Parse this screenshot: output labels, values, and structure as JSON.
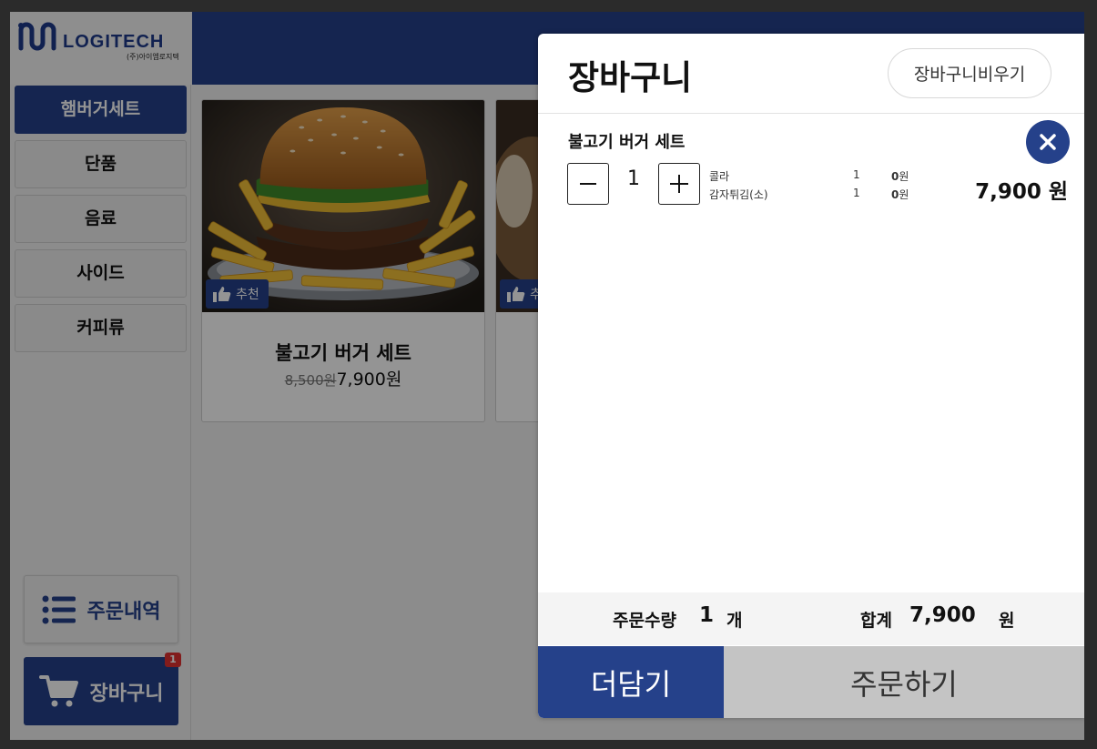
{
  "brand": {
    "logo_text": "LOGITECH",
    "sub_text": "(주)아이엠로지텍"
  },
  "sidebar": {
    "categories": [
      {
        "label": "햄버거세트",
        "active": true
      },
      {
        "label": "단품",
        "active": false
      },
      {
        "label": "음료",
        "active": false
      },
      {
        "label": "사이드",
        "active": false
      },
      {
        "label": "커피류",
        "active": false
      }
    ],
    "history_label": "주문내역",
    "cart_label": "장바구니",
    "cart_badge": "1"
  },
  "products": [
    {
      "badge": "추천",
      "name": "불고기 버거 세트",
      "old_price": "8,500원",
      "price": "7,900원"
    },
    {
      "badge": "추천"
    }
  ],
  "cart": {
    "title": "장바구니",
    "clear_label": "장바구니비우기",
    "item": {
      "name": "불고기 버거 세트",
      "quantity": "1",
      "options": [
        {
          "name": "콜라",
          "qty": "1",
          "price": "0",
          "unit": "원"
        },
        {
          "name": "감자튀김(소)",
          "qty": "1",
          "price": "0",
          "unit": "원"
        }
      ],
      "total": "7,900 원"
    },
    "summary": {
      "qty_label": "주문수량",
      "qty_value": "1",
      "qty_unit": "개",
      "total_label": "합계",
      "total_value": "7,900",
      "total_unit": "원"
    },
    "add_more_label": "더담기",
    "order_label": "주문하기"
  },
  "colors": {
    "primary": "#25418a",
    "badge_red": "#e03131"
  }
}
